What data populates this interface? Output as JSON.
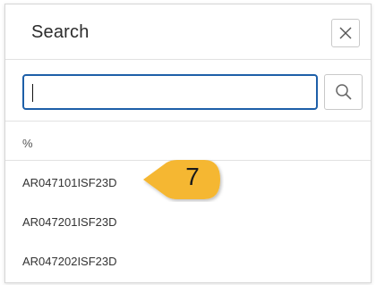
{
  "dialog": {
    "title": "Search",
    "close_icon": "close-icon",
    "search": {
      "value": "",
      "placeholder": "",
      "button_icon": "search-icon"
    },
    "filter_text": "%",
    "results": [
      "AR047101ISF23D",
      "AR047201ISF23D",
      "AR047202ISF23D"
    ]
  },
  "callout": {
    "number": "7",
    "color": "#f5b731"
  },
  "colors": {
    "input_border": "#1d5fa8",
    "divider": "#e2e2e2"
  }
}
